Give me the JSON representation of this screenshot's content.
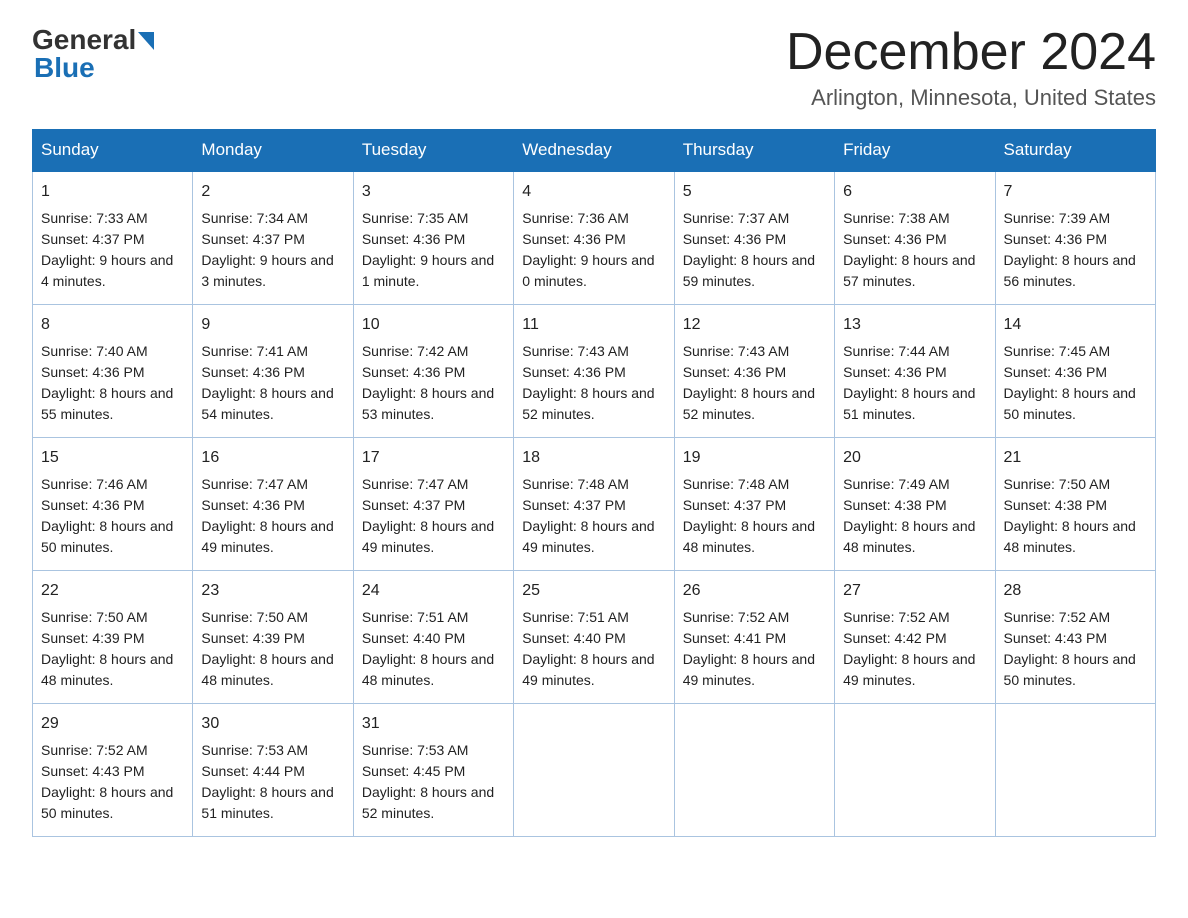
{
  "logo": {
    "general": "General",
    "blue": "Blue"
  },
  "title": {
    "month_year": "December 2024",
    "location": "Arlington, Minnesota, United States"
  },
  "weekdays": [
    "Sunday",
    "Monday",
    "Tuesday",
    "Wednesday",
    "Thursday",
    "Friday",
    "Saturday"
  ],
  "weeks": [
    [
      {
        "day": "1",
        "sunrise": "7:33 AM",
        "sunset": "4:37 PM",
        "daylight": "9 hours and 4 minutes."
      },
      {
        "day": "2",
        "sunrise": "7:34 AM",
        "sunset": "4:37 PM",
        "daylight": "9 hours and 3 minutes."
      },
      {
        "day": "3",
        "sunrise": "7:35 AM",
        "sunset": "4:36 PM",
        "daylight": "9 hours and 1 minute."
      },
      {
        "day": "4",
        "sunrise": "7:36 AM",
        "sunset": "4:36 PM",
        "daylight": "9 hours and 0 minutes."
      },
      {
        "day": "5",
        "sunrise": "7:37 AM",
        "sunset": "4:36 PM",
        "daylight": "8 hours and 59 minutes."
      },
      {
        "day": "6",
        "sunrise": "7:38 AM",
        "sunset": "4:36 PM",
        "daylight": "8 hours and 57 minutes."
      },
      {
        "day": "7",
        "sunrise": "7:39 AM",
        "sunset": "4:36 PM",
        "daylight": "8 hours and 56 minutes."
      }
    ],
    [
      {
        "day": "8",
        "sunrise": "7:40 AM",
        "sunset": "4:36 PM",
        "daylight": "8 hours and 55 minutes."
      },
      {
        "day": "9",
        "sunrise": "7:41 AM",
        "sunset": "4:36 PM",
        "daylight": "8 hours and 54 minutes."
      },
      {
        "day": "10",
        "sunrise": "7:42 AM",
        "sunset": "4:36 PM",
        "daylight": "8 hours and 53 minutes."
      },
      {
        "day": "11",
        "sunrise": "7:43 AM",
        "sunset": "4:36 PM",
        "daylight": "8 hours and 52 minutes."
      },
      {
        "day": "12",
        "sunrise": "7:43 AM",
        "sunset": "4:36 PM",
        "daylight": "8 hours and 52 minutes."
      },
      {
        "day": "13",
        "sunrise": "7:44 AM",
        "sunset": "4:36 PM",
        "daylight": "8 hours and 51 minutes."
      },
      {
        "day": "14",
        "sunrise": "7:45 AM",
        "sunset": "4:36 PM",
        "daylight": "8 hours and 50 minutes."
      }
    ],
    [
      {
        "day": "15",
        "sunrise": "7:46 AM",
        "sunset": "4:36 PM",
        "daylight": "8 hours and 50 minutes."
      },
      {
        "day": "16",
        "sunrise": "7:47 AM",
        "sunset": "4:36 PM",
        "daylight": "8 hours and 49 minutes."
      },
      {
        "day": "17",
        "sunrise": "7:47 AM",
        "sunset": "4:37 PM",
        "daylight": "8 hours and 49 minutes."
      },
      {
        "day": "18",
        "sunrise": "7:48 AM",
        "sunset": "4:37 PM",
        "daylight": "8 hours and 49 minutes."
      },
      {
        "day": "19",
        "sunrise": "7:48 AM",
        "sunset": "4:37 PM",
        "daylight": "8 hours and 48 minutes."
      },
      {
        "day": "20",
        "sunrise": "7:49 AM",
        "sunset": "4:38 PM",
        "daylight": "8 hours and 48 minutes."
      },
      {
        "day": "21",
        "sunrise": "7:50 AM",
        "sunset": "4:38 PM",
        "daylight": "8 hours and 48 minutes."
      }
    ],
    [
      {
        "day": "22",
        "sunrise": "7:50 AM",
        "sunset": "4:39 PM",
        "daylight": "8 hours and 48 minutes."
      },
      {
        "day": "23",
        "sunrise": "7:50 AM",
        "sunset": "4:39 PM",
        "daylight": "8 hours and 48 minutes."
      },
      {
        "day": "24",
        "sunrise": "7:51 AM",
        "sunset": "4:40 PM",
        "daylight": "8 hours and 48 minutes."
      },
      {
        "day": "25",
        "sunrise": "7:51 AM",
        "sunset": "4:40 PM",
        "daylight": "8 hours and 49 minutes."
      },
      {
        "day": "26",
        "sunrise": "7:52 AM",
        "sunset": "4:41 PM",
        "daylight": "8 hours and 49 minutes."
      },
      {
        "day": "27",
        "sunrise": "7:52 AM",
        "sunset": "4:42 PM",
        "daylight": "8 hours and 49 minutes."
      },
      {
        "day": "28",
        "sunrise": "7:52 AM",
        "sunset": "4:43 PM",
        "daylight": "8 hours and 50 minutes."
      }
    ],
    [
      {
        "day": "29",
        "sunrise": "7:52 AM",
        "sunset": "4:43 PM",
        "daylight": "8 hours and 50 minutes."
      },
      {
        "day": "30",
        "sunrise": "7:53 AM",
        "sunset": "4:44 PM",
        "daylight": "8 hours and 51 minutes."
      },
      {
        "day": "31",
        "sunrise": "7:53 AM",
        "sunset": "4:45 PM",
        "daylight": "8 hours and 52 minutes."
      },
      null,
      null,
      null,
      null
    ]
  ]
}
